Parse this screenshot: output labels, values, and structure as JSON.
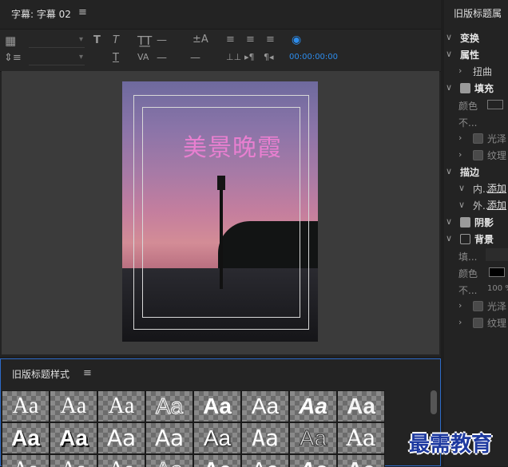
{
  "title_panel": {
    "tab_label": "字幕: 字幕 02",
    "menu_glyph": "≡",
    "timecode": "00:00:00:00",
    "title_text": "美景晚霞"
  },
  "styles_panel": {
    "tab_label": "旧版标题样式",
    "menu_glyph": "≡",
    "swatch_label": "Aa"
  },
  "right_panel": {
    "header": "旧版标题属",
    "transform": "变换",
    "properties": "属性",
    "distort": "扭曲",
    "fill": "填充",
    "fill_color": "颜色",
    "fill_opacity": "不...",
    "sheen": "光泽",
    "texture": "纹理",
    "stroke": "描边",
    "inner": "内...",
    "outer": "外...",
    "add": "添加",
    "shadow": "阴影",
    "background": "背景",
    "bg_fill": "填...",
    "bg_color": "颜色",
    "bg_opacity": "不...",
    "bg_opacity_value": "100 %",
    "bg_sheen": "光泽",
    "bg_texture": "纹理"
  },
  "watermark": "最需教育",
  "colors": {
    "accent": "#2d8ceb",
    "title_text": "#e87fd0",
    "panel_bg": "#232323"
  }
}
